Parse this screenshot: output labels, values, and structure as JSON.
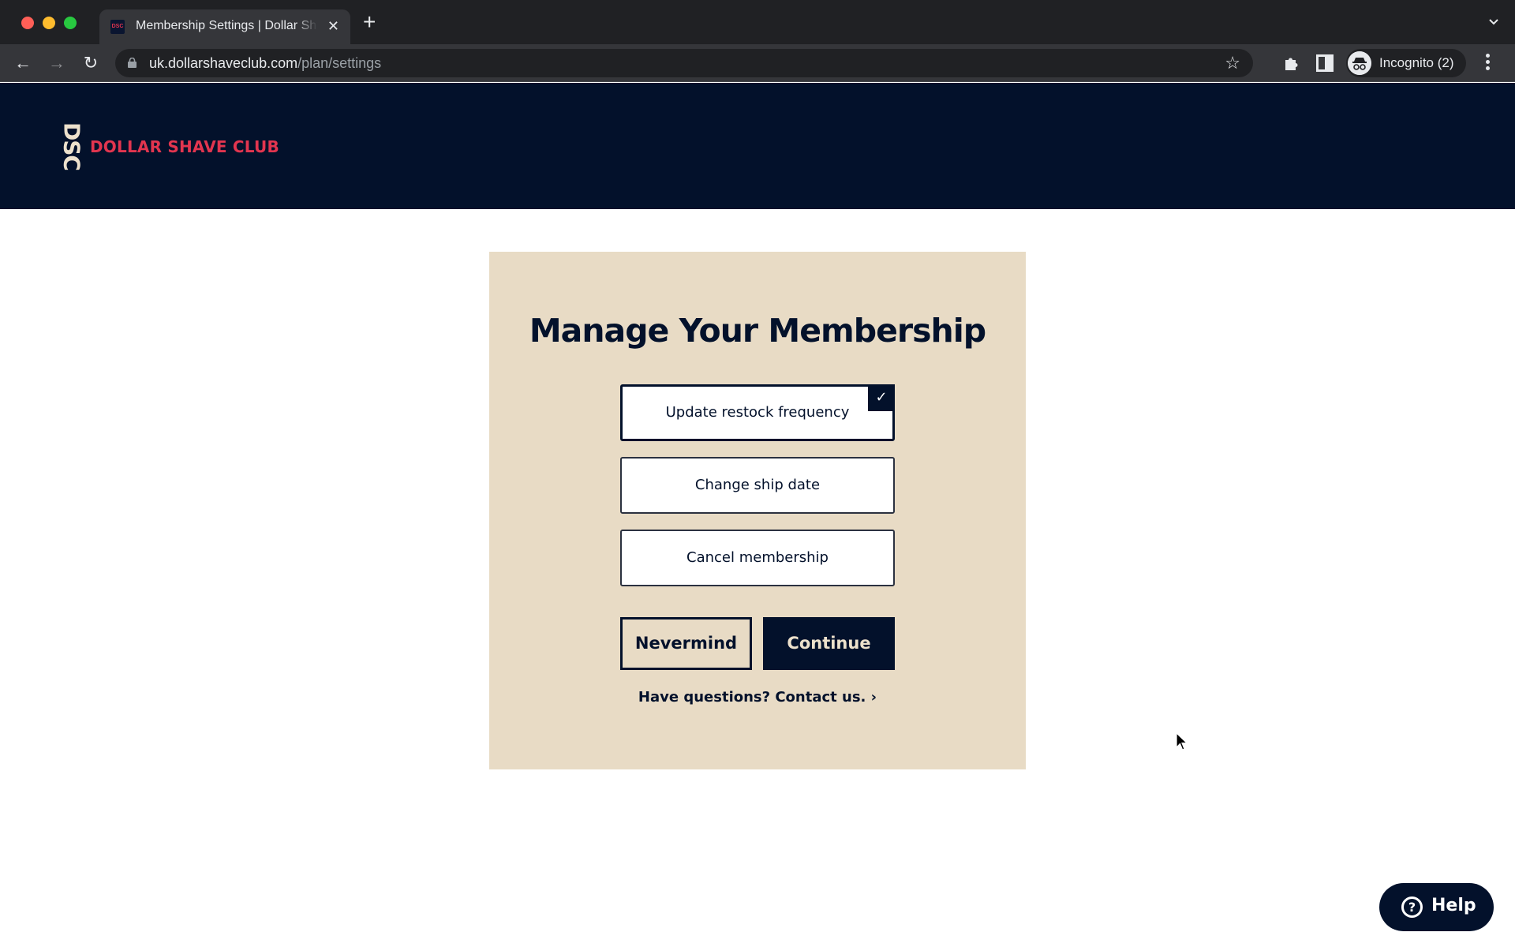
{
  "browser": {
    "tab_title": "Membership Settings | Dollar Shave Club",
    "tab_favicon_text": "DSC",
    "close_glyph": "✕",
    "new_tab_glyph": "+",
    "back_glyph": "←",
    "forward_glyph": "→",
    "reload_glyph": "↻",
    "url_host": "uk.dollarshaveclub.com",
    "url_path": "/plan/settings",
    "star_glyph": "☆",
    "profile_label": "Incognito (2)"
  },
  "site": {
    "logo_mark": "DSC",
    "logo_text": "DOLLAR SHAVE CLUB",
    "brand_colors": {
      "navy": "#03112b",
      "red": "#e2354f",
      "cream": "#e8dbc5"
    }
  },
  "card": {
    "title": "Manage Your Membership",
    "options": [
      {
        "label": "Update restock frequency",
        "selected": true
      },
      {
        "label": "Change ship date",
        "selected": false
      },
      {
        "label": "Cancel membership",
        "selected": false
      }
    ],
    "check_glyph": "✓",
    "nevermind_label": "Nevermind",
    "continue_label": "Continue",
    "contact_label": "Have questions? Contact us. ›"
  },
  "help": {
    "icon_glyph": "?",
    "label": "Help"
  }
}
